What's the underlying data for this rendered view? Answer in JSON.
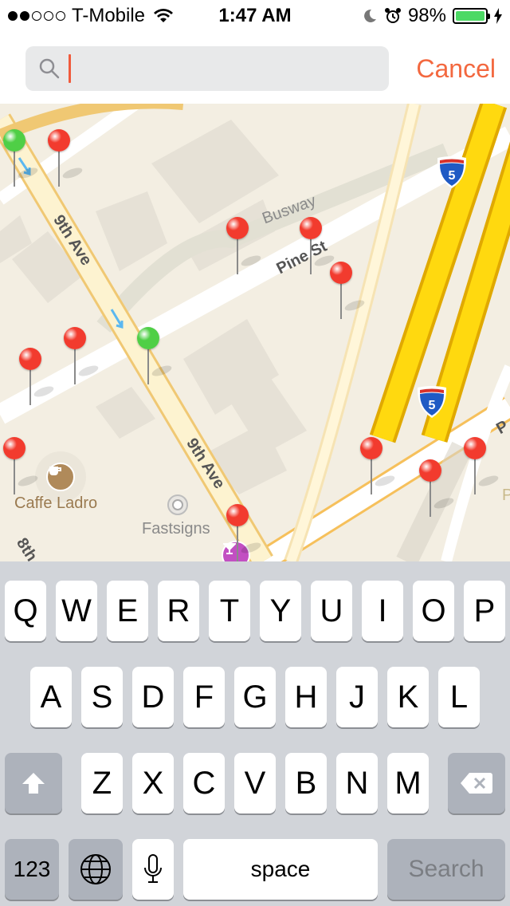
{
  "status_bar": {
    "carrier": "T-Mobile",
    "signal_dots_filled": 2,
    "signal_dots_total": 5,
    "time": "1:47 AM",
    "battery_percent": "98%",
    "battery_level": 0.98
  },
  "search": {
    "query": "",
    "cancel_label": "Cancel"
  },
  "map": {
    "streets": [
      "9th Ave",
      "9th Ave",
      "Busway",
      "Pine St",
      "8th"
    ],
    "highway_shield": "5",
    "places": [
      {
        "name": "Caffe Ladro",
        "icon": "coffee-icon"
      },
      {
        "name": "Fastsigns",
        "icon": "poi-icon"
      }
    ],
    "edge_letters": [
      "P",
      "P"
    ],
    "pin_colors": {
      "red": "#f23b2e",
      "green": "#4fcf46"
    }
  },
  "keyboard": {
    "row1": [
      "Q",
      "W",
      "E",
      "R",
      "T",
      "Y",
      "U",
      "I",
      "O",
      "P"
    ],
    "row2": [
      "A",
      "S",
      "D",
      "F",
      "G",
      "H",
      "J",
      "K",
      "L"
    ],
    "row3": [
      "Z",
      "X",
      "C",
      "V",
      "B",
      "N",
      "M"
    ],
    "numbers_label": "123",
    "space_label": "space",
    "search_label": "Search"
  },
  "colors": {
    "accent": "#f3683f",
    "highway": "#f7d31a",
    "road": "#ffffff",
    "map_bg": "#f3eee2"
  }
}
